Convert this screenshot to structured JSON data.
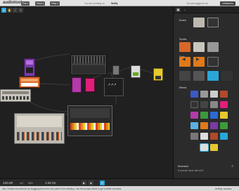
{
  "app": {
    "logo": "audiotool",
    "menus": [
      {
        "label": "File"
      },
      {
        "label": "View"
      },
      {
        "label": "Help"
      }
    ],
    "working_message": "You are working on",
    "username": "Sniffy",
    "login_message": "You are logged in as",
    "account_button": "softwareio"
  },
  "toolbar": {
    "tools": [
      {
        "icon": "pointer-icon",
        "symbol": "➤",
        "active": true
      },
      {
        "icon": "hand-icon",
        "symbol": "✋",
        "active": false
      },
      {
        "icon": "cable-icon",
        "symbol": "⌇",
        "active": false
      },
      {
        "icon": "zoom-icon",
        "symbol": "⚲",
        "active": false
      }
    ]
  },
  "panel": {
    "tabs": [
      {
        "icon": "devices-tab-icon",
        "symbol": "▦"
      },
      {
        "icon": "samples-tab-icon",
        "symbol": "♪"
      }
    ],
    "categories": {
      "drums": "Drums",
      "synths": "Synths",
      "tools": "Tools",
      "effects": "Effects"
    },
    "info_title": "Minimixer",
    "info_text": "A channel mixer with AUX",
    "info_icon": "⚙"
  },
  "transport": {
    "tempo": "120.00",
    "signature": "4/4",
    "swing": "60%",
    "position": "1:01:01",
    "buttons": [
      {
        "icon": "play-icon",
        "symbol": "▶"
      },
      {
        "icon": "stop-icon",
        "symbol": "■"
      },
      {
        "icon": "loop-icon",
        "symbol": "⟳"
      }
    ]
  },
  "status": {
    "message": "Info: Create new devices by dragging them from the panel to the desktop. Use the mouse wheel to get a better overview.",
    "activity": "Activity: ●●●●●●"
  },
  "colors": {
    "accent": "#2aa6d6",
    "desktop": "#202020",
    "panel": "#2b2b2b"
  }
}
